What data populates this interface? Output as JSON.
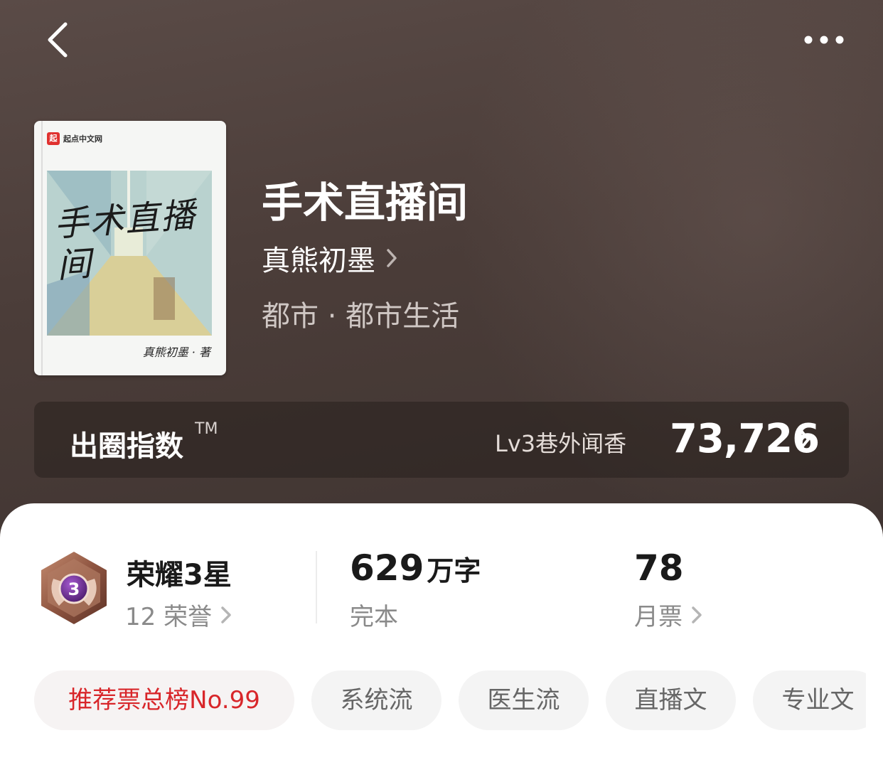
{
  "book": {
    "title": "手术直播间",
    "author": "真熊初墨",
    "genre": "都市 · 都市生活"
  },
  "cover": {
    "publisher": "起点中文网",
    "logo_mark": "起",
    "art_title": "手术直播间",
    "art_author": "真熊初墨 · 著"
  },
  "index": {
    "label": "出圈指数",
    "tm": "TM",
    "level": "Lv3巷外闻香",
    "value": "73,726"
  },
  "stats": {
    "honor_title": "荣耀3星",
    "badge_level": "3",
    "honor_count": "12 荣誉",
    "word_count": "629",
    "word_unit": "万字",
    "status": "完本",
    "monthly_votes": "78",
    "monthly_votes_label": "月票"
  },
  "tags": [
    {
      "label": "推荐票总榜No.99"
    },
    {
      "label": "系统流"
    },
    {
      "label": "医生流"
    },
    {
      "label": "直播文"
    },
    {
      "label": "专业文"
    }
  ],
  "icons": {
    "back": "chevron-left-icon",
    "more": "more-dots-icon",
    "chevron": "chevron-right-icon",
    "badge": "honor-badge-icon"
  },
  "colors": {
    "hero_bg": "#4b3d39",
    "rank_tag": "#d8262a",
    "badge_purple": "#6b2a8f"
  }
}
